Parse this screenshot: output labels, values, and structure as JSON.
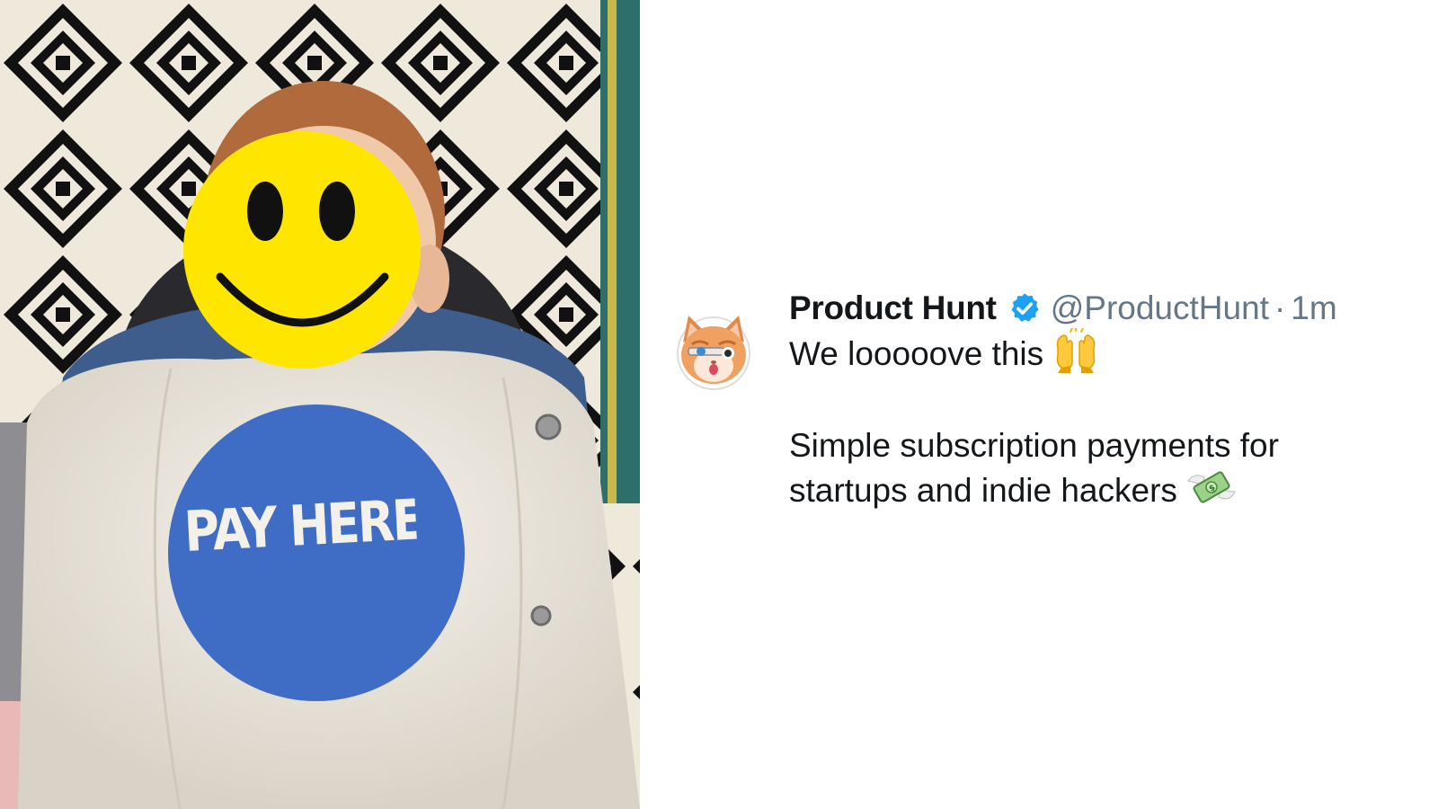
{
  "photo": {
    "description_icon": "baby-photo",
    "shirt_text": "PAY HERE"
  },
  "tweet": {
    "display_name": "Product Hunt",
    "handle": "@ProductHunt",
    "separator": "·",
    "time": "1m",
    "avatar_icon": "kitten-avatar",
    "verified_icon": "verified-badge-icon",
    "line1": "We looooove this",
    "line1_emoji": "raising-hands-emoji",
    "line2": "Simple subscription payments for",
    "line3": "startups and indie hackers",
    "line3_emoji": "money-with-wings-emoji"
  },
  "colors": {
    "verified": "#1da1f2",
    "name": "#14171a",
    "meta": "#657786",
    "shirt_circle": "#3f6cc4",
    "smiley": "#ffe600"
  }
}
